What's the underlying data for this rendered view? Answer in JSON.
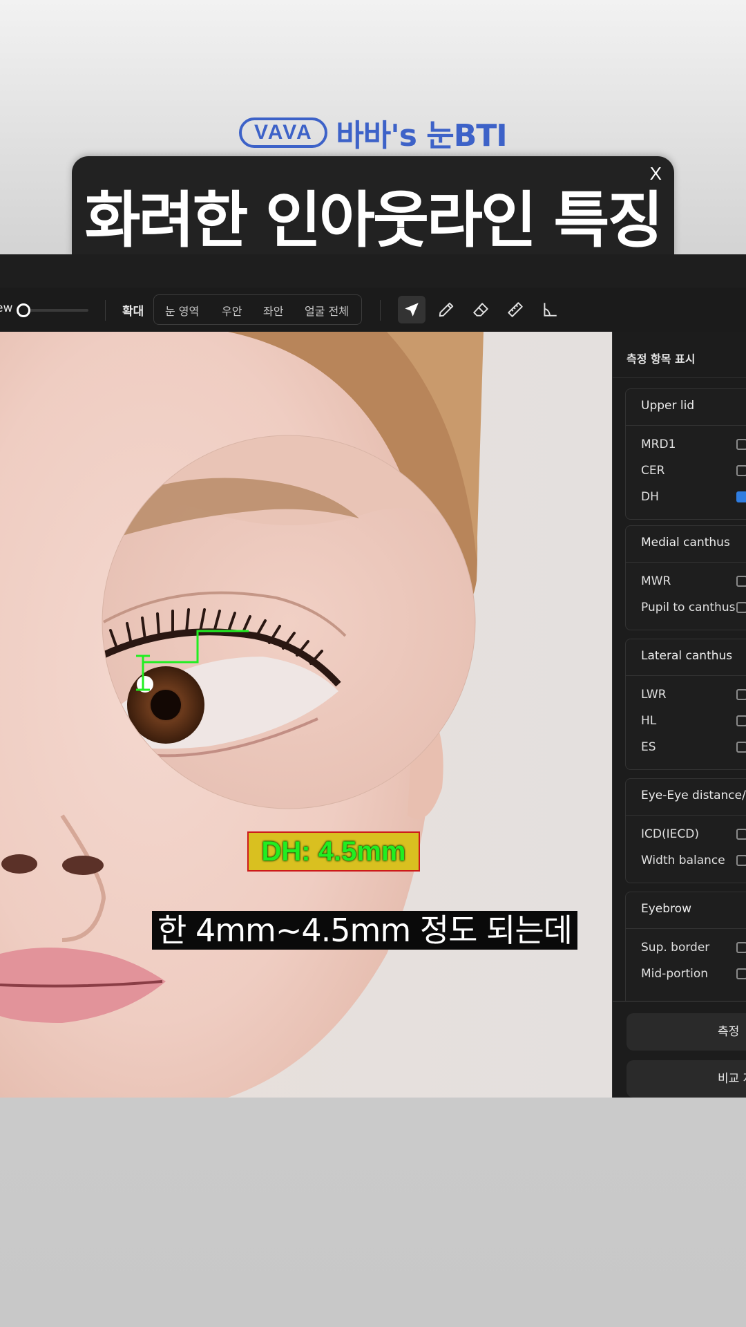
{
  "header": {
    "logo_text": "VAVA",
    "brand_title": "바바's 눈BTI",
    "title": "화려한 인아웃라인 특징",
    "close_label": "X"
  },
  "toolbar": {
    "view_label": "ew",
    "zoom_label": "확대",
    "segments": [
      "눈 영역",
      "우안",
      "좌안",
      "얼굴 전체"
    ],
    "tools": [
      "navigate-icon",
      "pencil-icon",
      "eraser-icon",
      "ruler-icon",
      "angle-icon"
    ]
  },
  "canvas": {
    "measurement_label": "DH: 4.5mm",
    "caption": "한 4mm~4.5mm 정도 되는데"
  },
  "panel": {
    "header": "측정 항목 표시",
    "groups": [
      {
        "title": "Upper lid",
        "items": [
          {
            "label": "MRD1",
            "checked": false
          },
          {
            "label": "CER",
            "checked": false
          },
          {
            "label": "DH",
            "checked": true
          }
        ]
      },
      {
        "title": "Medial canthus",
        "items": [
          {
            "label": "MWR",
            "checked": false
          },
          {
            "label": "Pupil to canthus",
            "checked": false
          }
        ]
      },
      {
        "title": "Lateral canthus",
        "items": [
          {
            "label": "LWR",
            "checked": false
          },
          {
            "label": "HL",
            "checked": false
          },
          {
            "label": "ES",
            "checked": false
          }
        ]
      },
      {
        "title": "Eye-Eye distance/b",
        "items": [
          {
            "label": "ICD(IECD)",
            "checked": false
          },
          {
            "label": "Width balance",
            "checked": false
          }
        ]
      },
      {
        "title": "Eyebrow",
        "items": [
          {
            "label": "Sup. border",
            "checked": false
          },
          {
            "label": "Mid-portion",
            "checked": false
          }
        ]
      }
    ],
    "buttons": [
      "측정",
      "비교 저"
    ]
  },
  "colors": {
    "brand_blue": "#3d62c8",
    "title_bg": "#222222",
    "check_blue": "#2f7de1",
    "measure_green": "#21ee21",
    "label_yellow": "#d9c020",
    "label_border": "#cc1a1a"
  }
}
